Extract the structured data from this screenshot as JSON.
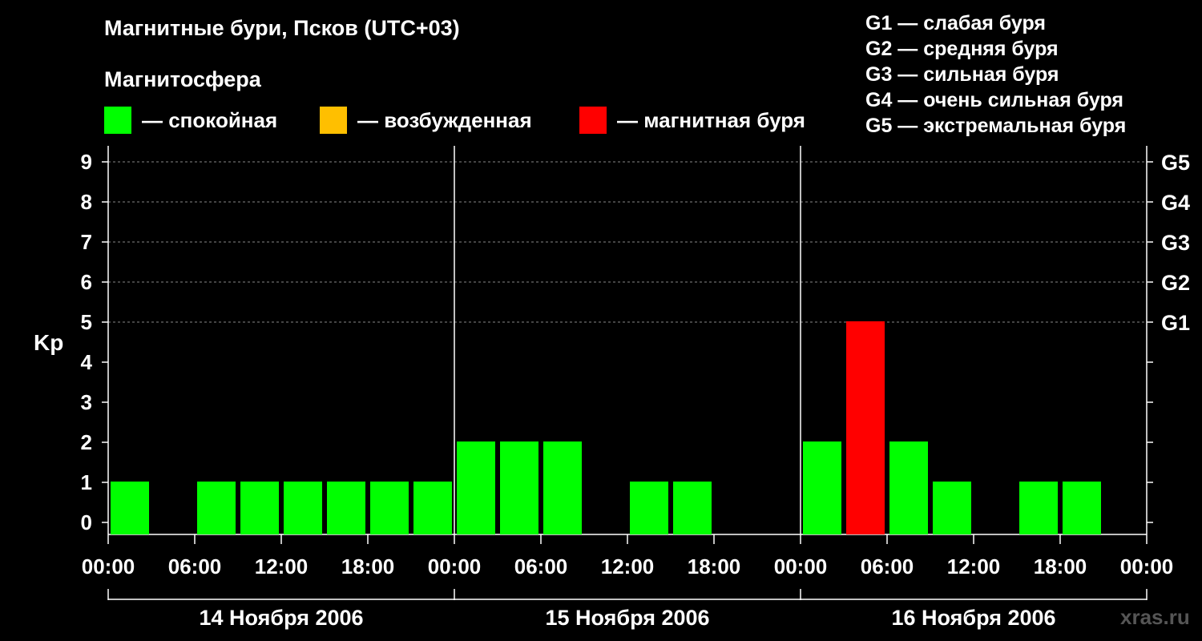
{
  "header": {
    "title": "Магнитные бури, Псков (UTC+03)",
    "subtitle": "Магнитосфера"
  },
  "legend": [
    {
      "label": "— спокойная",
      "color": "#00ff00"
    },
    {
      "label": "— возбужденная",
      "color": "#ffbf00"
    },
    {
      "label": "— магнитная буря",
      "color": "#ff0000"
    }
  ],
  "storm_scale": [
    "G1 — слабая буря",
    "G2 — средняя буря",
    "G3 — сильная буря",
    "G4 — очень сильная буря",
    "G5 — экстремальная буря"
  ],
  "watermark": "xras.ru",
  "chart_data": {
    "type": "bar",
    "ylabel": "Kp",
    "ylim": [
      0,
      9
    ],
    "yticks": [
      0,
      1,
      2,
      3,
      4,
      5,
      6,
      7,
      8,
      9
    ],
    "right_axis_labels": [
      {
        "at": 5,
        "label": "G1"
      },
      {
        "at": 6,
        "label": "G2"
      },
      {
        "at": 7,
        "label": "G3"
      },
      {
        "at": 8,
        "label": "G4"
      },
      {
        "at": 9,
        "label": "G5"
      }
    ],
    "grid_lines_at": [
      5,
      6,
      7,
      8,
      9
    ],
    "x_tick_labels": [
      "00:00",
      "06:00",
      "12:00",
      "18:00",
      "00:00",
      "06:00",
      "12:00",
      "18:00",
      "00:00",
      "06:00",
      "12:00",
      "18:00",
      "00:00"
    ],
    "days": [
      "14 Ноября 2006",
      "15 Ноября 2006",
      "16 Ноября 2006"
    ],
    "intervals_per_day": 8,
    "series": [
      {
        "day": "14 Ноября 2006",
        "values": [
          1,
          0,
          1,
          1,
          1,
          1,
          1,
          1
        ]
      },
      {
        "day": "15 Ноября 2006",
        "values": [
          2,
          2,
          2,
          0,
          1,
          1,
          0,
          0
        ]
      },
      {
        "day": "16 Ноября 2006",
        "values": [
          2,
          5,
          2,
          1,
          0,
          1,
          1,
          0
        ]
      }
    ],
    "colors": {
      "quiet": "#00ff00",
      "storm": "#ff0000"
    }
  }
}
